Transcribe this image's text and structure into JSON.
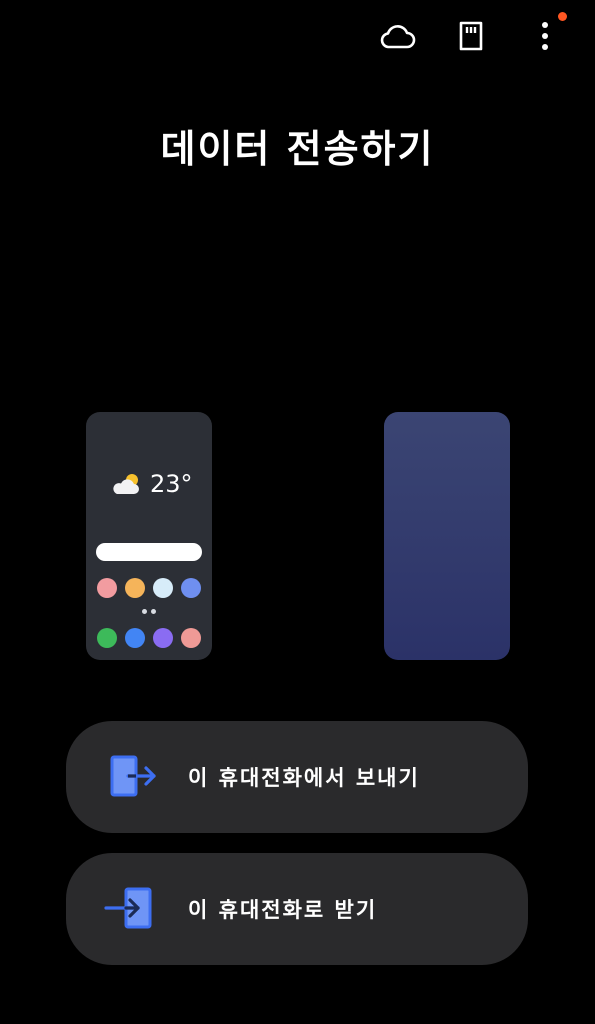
{
  "topbar": {
    "icons": [
      "cloud-icon",
      "sd-card-icon",
      "more-vert-icon"
    ],
    "notification_color": "#ff5722"
  },
  "title": "데이터 전송하기",
  "source_phone": {
    "weather_icon": "partly-cloudy-icon",
    "temperature": "23°",
    "app_icon_colors_row1": [
      "#f29ca0",
      "#f5b45a",
      "#d7ecf9",
      "#6f8ff0"
    ],
    "app_icon_colors_row2": [
      "#3dba5a",
      "#4285f4",
      "#8a6cf2",
      "#ef9a96"
    ]
  },
  "target_phone": {
    "color_top": "#3b4573",
    "color_bottom": "#2b3268"
  },
  "actions": {
    "send_label": "이 휴대전화에서 보내기",
    "receive_label": "이 휴대전화로 받기",
    "accent": "#4a7cf3",
    "button_bg": "#2a2a2c"
  }
}
